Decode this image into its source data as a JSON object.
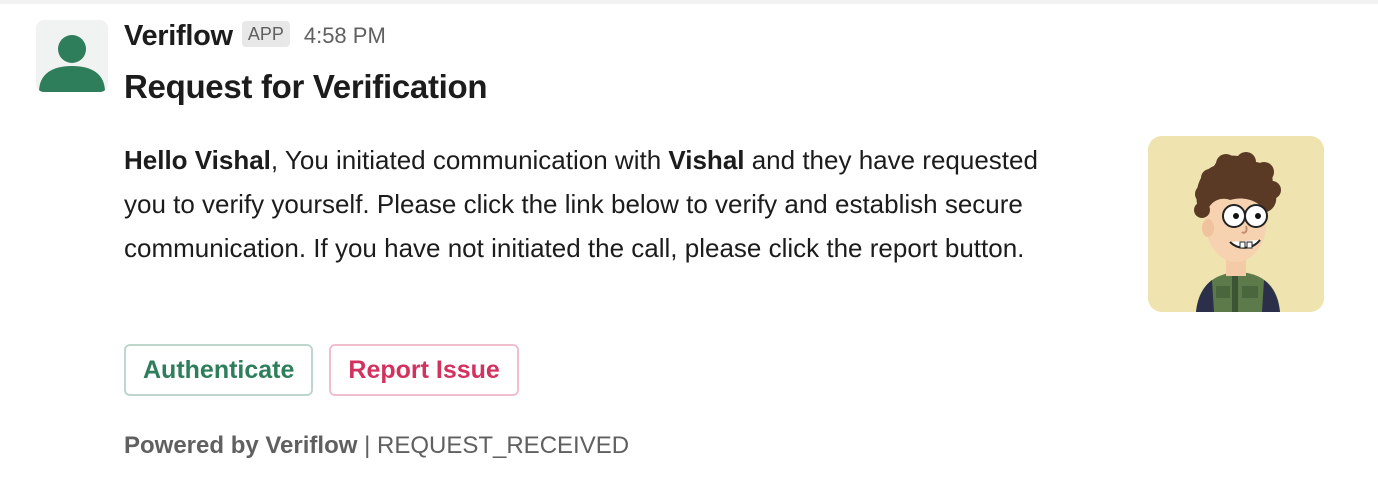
{
  "message": {
    "sender": "Veriflow",
    "badge": "APP",
    "time": "4:58 PM",
    "title": "Request for Verification",
    "body": {
      "greeting_bold": "Hello Vishal",
      "part1": ", You initiated communication with ",
      "name_bold": "Vishal",
      "part2": " and they have requested you to verify yourself. Please click the link below to verify and establish secure communication. If you have not initiated the call, please click the report button."
    },
    "actions": {
      "authenticate_label": "Authenticate",
      "report_label": "Report Issue"
    },
    "footer": {
      "powered_by": "Powered by Veriflow",
      "separator": " | ",
      "status": "REQUEST_RECEIVED"
    }
  },
  "colors": {
    "avatar_green": "#2e7d5b",
    "authenticate_text": "#2e7d5b",
    "report_text": "#d1325e",
    "thumbnail_bg": "#efe4b0"
  },
  "icons": {
    "avatar": "user-avatar-icon",
    "thumbnail": "cartoon-portrait-image"
  }
}
